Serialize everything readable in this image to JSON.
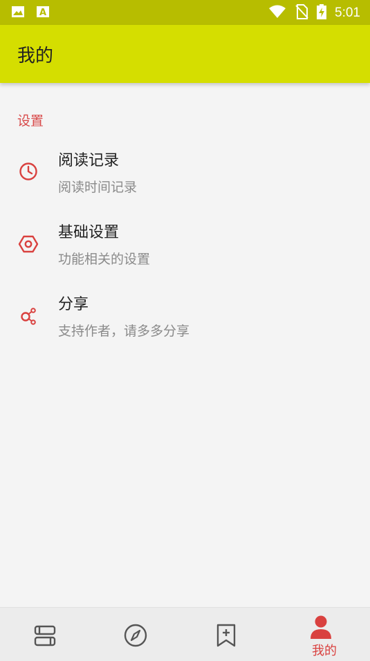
{
  "status_bar": {
    "time": "5:01",
    "icons": [
      "image-icon",
      "text-icon",
      "wifi-icon",
      "no-sim-icon",
      "battery-charging-icon"
    ]
  },
  "app_bar": {
    "title": "我的"
  },
  "settings": {
    "section_label": "设置",
    "items": [
      {
        "title": "阅读记录",
        "summary": "阅读时间记录",
        "icon": "clock-icon"
      },
      {
        "title": "基础设置",
        "summary": "功能相关的设置",
        "icon": "settings-hex-icon"
      },
      {
        "title": "分享",
        "summary": "支持作者，请多多分享",
        "icon": "share-icon"
      }
    ]
  },
  "bottom_nav": {
    "items": [
      {
        "icon": "bookshelf-icon",
        "label": ""
      },
      {
        "icon": "compass-icon",
        "label": ""
      },
      {
        "icon": "bookmark-add-icon",
        "label": ""
      },
      {
        "icon": "person-icon",
        "label": "我的",
        "active": true
      }
    ]
  },
  "colors": {
    "status_bar": "#b7bd00",
    "app_bar": "#d5de00",
    "accent": "#d9413f",
    "background": "#f4f4f4"
  }
}
